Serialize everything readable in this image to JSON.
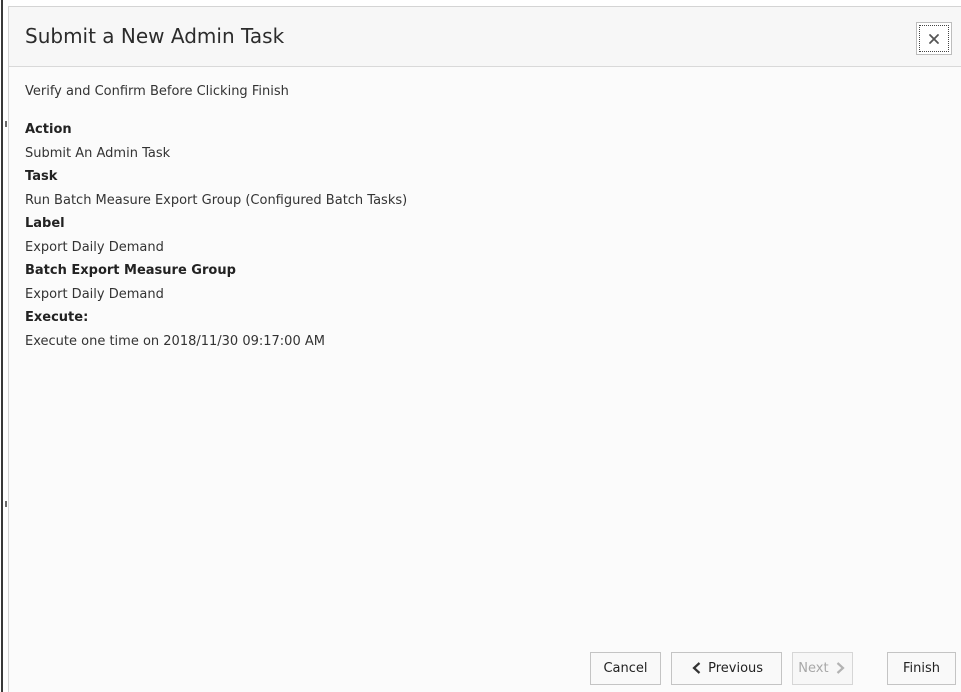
{
  "dialog": {
    "title": "Submit a New Admin Task",
    "close_symbol": "×",
    "instruction": "Verify and Confirm Before Clicking Finish"
  },
  "fields": [
    {
      "label": "Action",
      "value": "Submit An Admin Task"
    },
    {
      "label": "Task",
      "value": "Run Batch Measure Export Group (Configured Batch Tasks)"
    },
    {
      "label": "Label",
      "value": "Export Daily Demand"
    },
    {
      "label": "Batch Export Measure Group",
      "value": "Export Daily Demand"
    },
    {
      "label": "Execute:",
      "value": "Execute one time on 2018/11/30 09:17:00 AM"
    }
  ],
  "buttons": {
    "cancel": "Cancel",
    "previous": "Previous",
    "next": "Next",
    "finish": "Finish"
  },
  "icons": {
    "close": "close-icon",
    "previous": "chevron-left-icon",
    "next": "chevron-right-icon"
  }
}
